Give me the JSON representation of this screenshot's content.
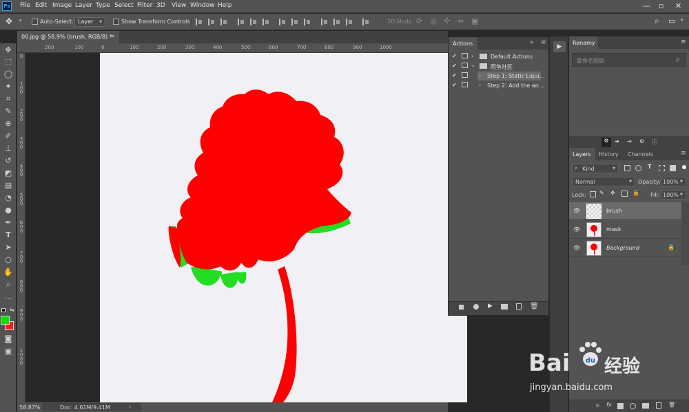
{
  "menubar": {
    "logo": "Ps",
    "items": [
      "File",
      "Edit",
      "Image",
      "Layer",
      "Type",
      "Select",
      "Filter",
      "3D",
      "View",
      "Window",
      "Help"
    ],
    "controls": [
      "—",
      "▫",
      "✕"
    ]
  },
  "options": {
    "auto_select_label": "Auto-Select:",
    "auto_select_value": "Layer",
    "transform_label": "Show Transform Controls",
    "mode_label": "3D Mode:"
  },
  "document": {
    "tab_title": "00.jpg @ 58.9% (brush, RGB/8) *",
    "tab_close": "×"
  },
  "ruler": {
    "top_ticks": [
      "200",
      "100",
      "0",
      "100",
      "200",
      "300",
      "400",
      "500",
      "600",
      "700",
      "800",
      "900",
      "1000"
    ],
    "left_ticks": [
      "0",
      "1 0 0",
      "2 0 0",
      "3 0 0",
      "4 0 0",
      "5 0 0",
      "6 0 0",
      "7 0 0",
      "8 0 0",
      "9 0 0",
      "1 0 0 0"
    ]
  },
  "status": {
    "zoom": "58.87%",
    "doc": "Doc: 4.61M/9.41M",
    "arrow": "›"
  },
  "actions_panel": {
    "title": "Actions",
    "rows": [
      {
        "label": "Default Actions",
        "type": "set"
      },
      {
        "label": "陌鱼社区",
        "type": "set"
      },
      {
        "label": "Step 1: Static Liqui...",
        "type": "action"
      },
      {
        "label": "Step 2: Add the an...",
        "type": "action"
      }
    ]
  },
  "rename_panel": {
    "title": "Renamy",
    "placeholder": "重命名图层"
  },
  "layers_panel": {
    "tabs": [
      "Layers",
      "History",
      "Channels"
    ],
    "filter_label": "Kind",
    "blend_mode": "Normal",
    "opacity_label": "Opacity:",
    "opacity_value": "100%",
    "lock_label": "Lock:",
    "fill_label": "Fill:",
    "fill_value": "100%",
    "layers": [
      {
        "name": "brush",
        "selected": true
      },
      {
        "name": "mask",
        "selected": false
      },
      {
        "name": "Background",
        "selected": false,
        "locked": true
      }
    ]
  },
  "watermark": {
    "brand": "Bai",
    "brand2": "du",
    "cn": "经验",
    "url": "jingyan.baidu.com"
  },
  "colors": {
    "foreground": "#00e000",
    "background": "#ff1a1a",
    "flower": "#ff0000",
    "highlight": "#22dd22"
  }
}
